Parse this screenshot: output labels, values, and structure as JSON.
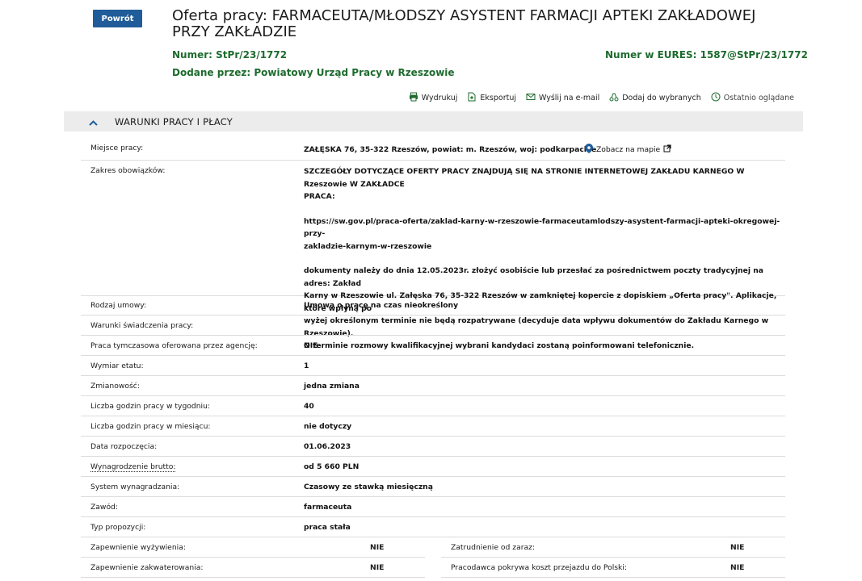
{
  "header": {
    "back_label": "Powrót",
    "title": "Oferta pracy: FARMACEUTA/MŁODSZY ASYSTENT FARMACJI APTEKI ZAKŁADOWEJ PRZY ZAKŁADZIE",
    "number_label": "Numer:",
    "number_value": "StPr/23/1772",
    "eures_label": "Numer w EURES:",
    "eures_value": "1587@StPr/23/1772",
    "added_label": "Dodane przez:",
    "added_value": "Powiatowy Urząd Pracy w Rzeszowie"
  },
  "toolbar": {
    "print": "Wydrukuj",
    "export": "Eksportuj",
    "email": "Wyślij na e-mail",
    "favorites": "Dodaj do wybranych",
    "recent": "Ostatnio oglądane"
  },
  "section": {
    "title": "WARUNKI PRACY I PŁACY"
  },
  "fields": {
    "location_label": "Miejsce pracy:",
    "location_value": "ZAŁĘSKA 76, 35-322 Rzeszów, powiat: m. Rzeszów, woj: podkarpackie",
    "map_link": "Zobacz na mapie",
    "duties_label": "Zakres obowiązków:",
    "duties_p1_line1": "SZCZEGÓŁY DOTYCZĄCE OFERTY PRACY ZNAJDUJĄ SIĘ NA STRONIE INTERNETOWEJ ZAKŁADU KARNEGO W Rzeszowie W ZAKŁADCE",
    "duties_p1_line2": "PRACA:",
    "duties_p2_line1": "https://sw.gov.pl/praca-oferta/zaklad-karny-w-rzeszowie-farmaceutamlodszy-asystent-farmacji-apteki-okregowej-przy-",
    "duties_p2_line2": "zakladzie-karnym-w-rzeszowie",
    "duties_p3_line1": "dokumenty należy do dnia 12.05.2023r. złożyć osobiście lub przesłać za pośrednictwem poczty tradycyjnej na adres: Zakład",
    "duties_p3_line2": "Karny w Rzeszowie ul. Załęska 76, 35-322 Rzeszów w zamkniętej kopercie z dopiskiem „Oferta pracy\". Aplikacje, które wpłyną po",
    "duties_p3_line3": "wyżej określonym terminie nie będą rozpatrywane (decyduje data wpływu dokumentów do Zakładu Karnego w Rzeszowie).",
    "duties_p3_line4": "O terminie rozmowy kwalifikacyjnej wybrani kandydaci zostaną poinformowani telefonicznie.",
    "contract_label": "Rodzaj umowy:",
    "contract_value": "Umowa o pracę na czas nieokreślony",
    "conditions_label": "Warunki świadczenia pracy:",
    "conditions_value": "",
    "agency_label": "Praca tymczasowa oferowana przez agencję:",
    "agency_value": "NIE",
    "fte_label": "Wymiar etatu:",
    "fte_value": "1",
    "shifts_label": "Zmianowość:",
    "shifts_value": "jedna zmiana",
    "hours_week_label": "Liczba godzin pracy w tygodniu:",
    "hours_week_value": "40",
    "hours_month_label": "Liczba godzin pracy w miesiącu:",
    "hours_month_value": "nie dotyczy",
    "start_label": "Data rozpoczęcia:",
    "start_value": "01.06.2023",
    "salary_label": "Wynagrodzenie brutto:",
    "salary_value": "od 5 660 PLN",
    "pay_system_label": "System wynagradzania:",
    "pay_system_value": "Czasowy ze stawką miesięczną",
    "profession_label": "Zawód:",
    "profession_value": "farmaceuta",
    "offer_type_label": "Typ propozycji:",
    "offer_type_value": "praca stała",
    "meals_label": "Zapewnienie wyżywienia:",
    "meals_value": "NIE",
    "immediate_label": "Zatrudnienie od zaraz:",
    "immediate_value": "NIE",
    "housing_label": "Zapewnienie zakwaterowania:",
    "housing_value": "NIE",
    "travel_label": "Pracodawca pokrywa koszt przejazdu do Polski:",
    "travel_value": "NIE"
  },
  "colors": {
    "primary": "#1f5c99",
    "green": "#1e6b2e",
    "section_bg": "#ececec",
    "map_pin": "#1f5c99"
  }
}
